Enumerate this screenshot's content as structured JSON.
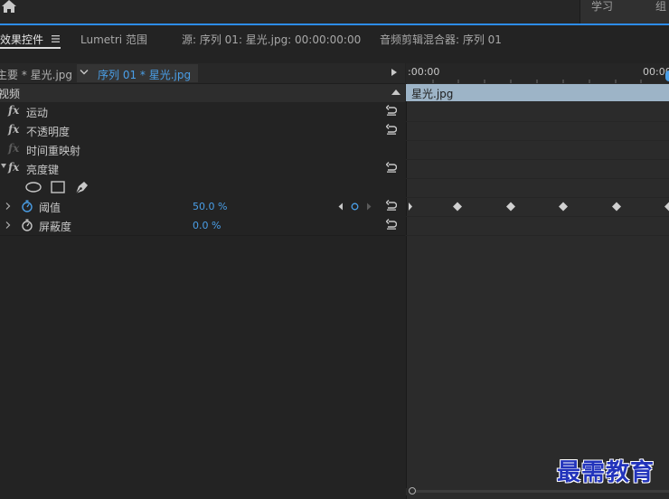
{
  "workspace": {
    "learn_label": "学习",
    "assembly_label": "组"
  },
  "tabs": [
    {
      "label": "效果控件"
    },
    {
      "label": "Lumetri 范围"
    },
    {
      "label": "源: 序列 01: 星光.jpg: 00:00:00:00"
    },
    {
      "label": "音频剪辑混合器: 序列 01"
    }
  ],
  "sequence": {
    "master_clip": "主要 * 星光.jpg",
    "sequence_clip": "序列 01 * 星光.jpg"
  },
  "timeline": {
    "timecode_start": ":00:00",
    "timecode_end": "00:00",
    "clip_name": "星光.jpg"
  },
  "effects": {
    "section_label": "视频",
    "motion": "运动",
    "opacity": "不透明度",
    "time_remap": "时间重映射",
    "luma_key": "亮度键",
    "fx_glyph": "fx"
  },
  "properties": {
    "threshold_label": "阈值",
    "threshold_value": "50.0 %",
    "cutoff_label": "屏蔽度",
    "cutoff_value": "0.0 %"
  },
  "keyframes": {
    "threshold_count": 5
  },
  "watermark": "最需教育",
  "colors": {
    "accent": "#2d8ceb",
    "value_blue": "#4a9fe8",
    "clip_bar": "#9db4c7",
    "watermark": "#2233bb"
  }
}
